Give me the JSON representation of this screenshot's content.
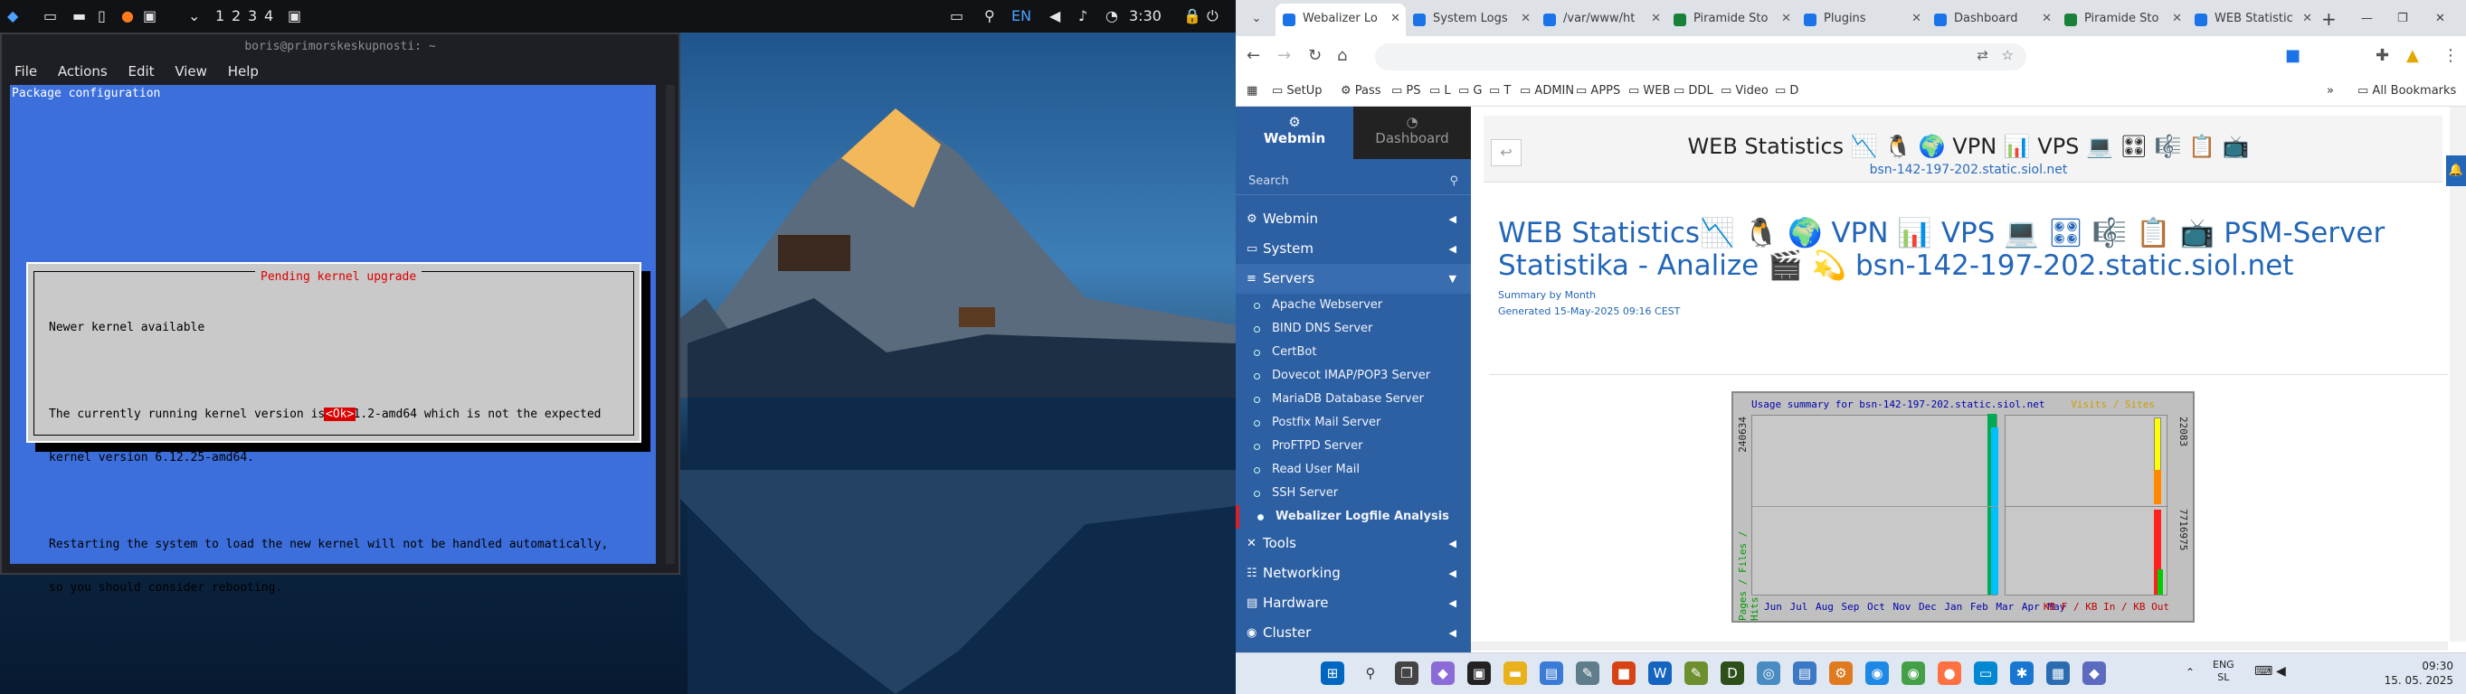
{
  "panel": {
    "workspaces": [
      "1",
      "2",
      "3",
      "4"
    ],
    "lang": "EN",
    "time": "3:30"
  },
  "terminal": {
    "title": "boris@primorskeskupnosti: ~",
    "menu": [
      "File",
      "Actions",
      "Edit",
      "View",
      "Help"
    ],
    "header": "Package configuration",
    "dialog": {
      "title": "Pending kernel upgrade",
      "lines": [
        "Newer kernel available",
        "",
        "The currently running kernel version is 6.11.2-amd64 which is not the expected",
        "kernel version 6.12.25-amd64.",
        "",
        "Restarting the system to load the new kernel will not be handled automatically,",
        "so you should consider rebooting."
      ],
      "ok": "<Ok>"
    }
  },
  "browser": {
    "tabs": [
      {
        "label": "Webalizer Lo",
        "color": "#1a73e8"
      },
      {
        "label": "System Logs",
        "color": "#1a73e8"
      },
      {
        "label": "/var/www/ht",
        "color": "#1a73e8"
      },
      {
        "label": "Piramide Sto",
        "color": "#188038"
      },
      {
        "label": "Plugins",
        "color": "#1a73e8"
      },
      {
        "label": "Dashboard",
        "color": "#1a73e8"
      },
      {
        "label": "Piramide Sto",
        "color": "#188038"
      },
      {
        "label": "WEB Statistic",
        "color": "#1a73e8"
      }
    ],
    "bookmarks": [
      "SetUp",
      "Pass",
      "PS",
      "L",
      "G",
      "T",
      "ADMIN",
      "APPS",
      "WEB",
      "DDL",
      "Video",
      "D"
    ],
    "all_bookmarks": "All Bookmarks"
  },
  "webmin": {
    "tab_webmin": "Webmin",
    "tab_dashboard": "Dashboard",
    "search_placeholder": "Search",
    "menu_top": [
      "Webmin",
      "System",
      "Servers"
    ],
    "servers": [
      "Apache Webserver",
      "BIND DNS Server",
      "CertBot",
      "Dovecot IMAP/POP3 Server",
      "MariaDB Database Server",
      "Postfix Mail Server",
      "ProFTPD Server",
      "Read User Mail",
      "SSH Server",
      "Webalizer Logfile Analysis"
    ],
    "menu_bottom": [
      "Tools",
      "Networking",
      "Hardware",
      "Cluster"
    ]
  },
  "page": {
    "title": "WEB Statistics 📉 🐧 🌍 VPN 📊 VPS 💻 🎛 🎼 📋 📺",
    "host": "bsn-142-197-202.static.siol.net",
    "heading": "WEB Statistics📉 🐧 🌍 VPN 📊 VPS 💻 🎛 🎼 📋 📺 PSM-Server Statistika - Analize 🎬 💫 bsn-142-197-202.static.siol.net",
    "summary": "Summary by Month",
    "generated": "Generated 15-May-2025 09:16 CEST",
    "graph": {
      "title": "Usage summary for bsn-142-197-202.static.siol.net",
      "visits_sites": "Visits / Sites",
      "left_axis": "Pages / Files / Hits",
      "y_top_left": "240634",
      "y_top_right": "22083",
      "y_bottom_right": "7716975",
      "months": "Jun Jul Aug Sep Oct Nov Dec Jan Feb Mar Apr May",
      "kb_legend": "KB F / KB In / KB Out"
    }
  },
  "taskbar": {
    "lang": "ENG",
    "lang2": "SL",
    "time": "09:30",
    "date": "15. 05. 2025"
  }
}
